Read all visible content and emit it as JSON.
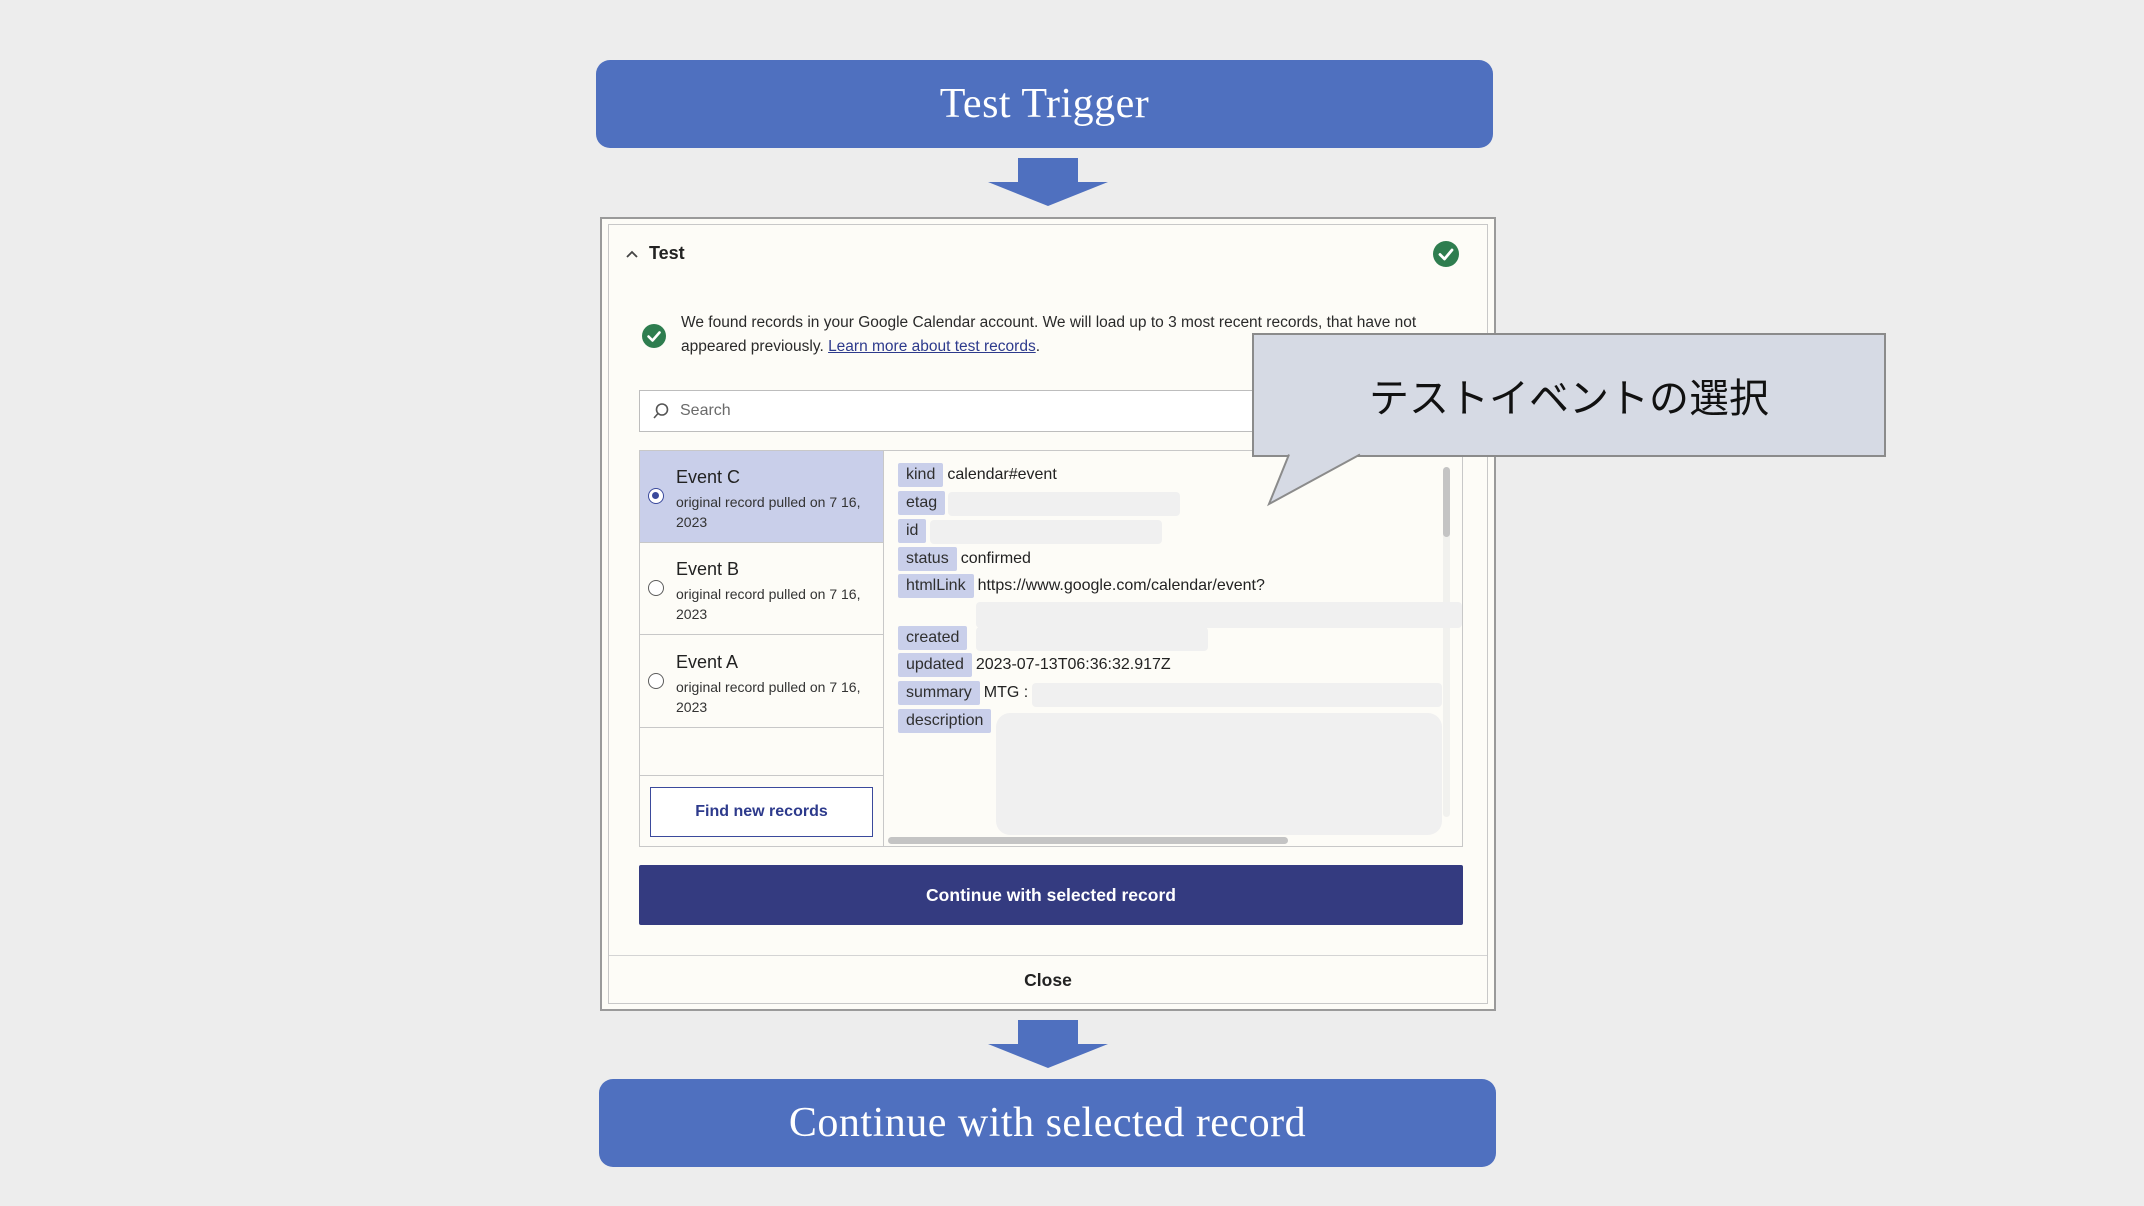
{
  "banners": {
    "top": "Test Trigger",
    "bottom": "Continue with selected record"
  },
  "callout": {
    "text": "テストイベントの選択"
  },
  "panel": {
    "section_title": "Test",
    "notice_text": "We found records in your Google Calendar account. We will load up to 3 most recent records, that have not appeared previously.",
    "notice_link": "Learn more about test records",
    "search_placeholder": "Search",
    "records": [
      {
        "title": "Event C",
        "subtitle": "original record pulled on 7 16, 2023",
        "selected": true
      },
      {
        "title": "Event B",
        "subtitle": "original record pulled on 7 16, 2023",
        "selected": false
      },
      {
        "title": "Event A",
        "subtitle": "original record pulled on 7 16, 2023",
        "selected": false
      }
    ],
    "find_button": "Find new records",
    "fields": [
      {
        "key": "kind",
        "value": "calendar#event"
      },
      {
        "key": "etag",
        "value": ""
      },
      {
        "key": "id",
        "value": ""
      },
      {
        "key": "status",
        "value": "confirmed"
      },
      {
        "key": "htmlLink",
        "value": "https://www.google.com/calendar/event?"
      },
      {
        "key": "created",
        "value": ""
      },
      {
        "key": "updated",
        "value": "2023-07-13T06:36:32.917Z"
      },
      {
        "key": "summary",
        "value": "MTG :"
      },
      {
        "key": "description",
        "value": ""
      }
    ],
    "continue_button": "Continue with selected record",
    "close_button": "Close"
  },
  "colors": {
    "banner": "#4f70bf",
    "primary_button": "#343b80",
    "selected_row": "#c9cfea",
    "success": "#2e7d4f"
  },
  "icons": {
    "header_status": "check-circle-icon",
    "notice_status": "check-circle-icon",
    "search": "search-icon",
    "collapse": "chevron-up-icon"
  }
}
